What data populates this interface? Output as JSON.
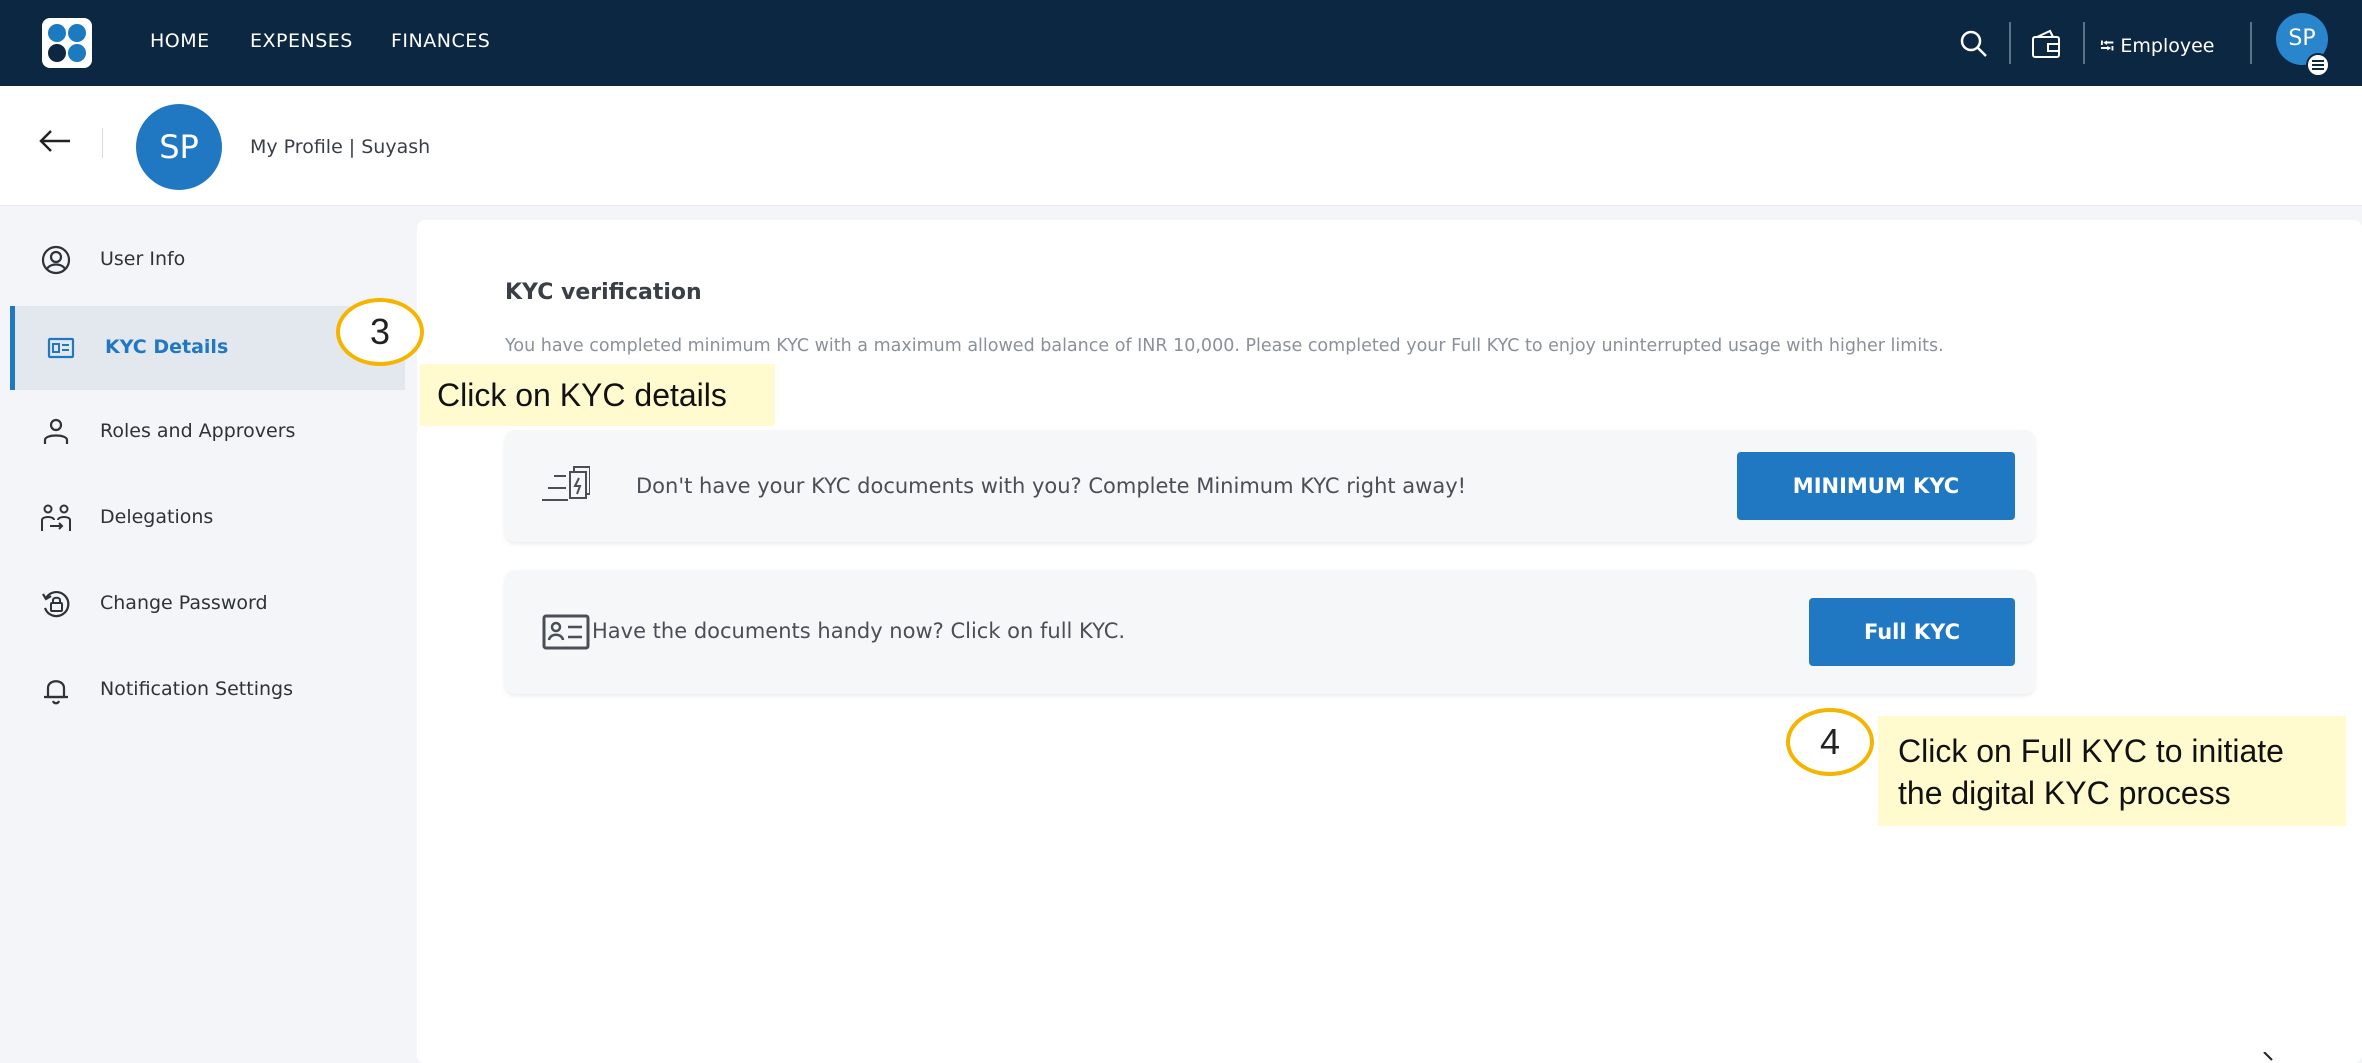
{
  "topnav": {
    "links": [
      "HOME",
      "EXPENSES",
      "FINANCES"
    ],
    "switch_label": "⭾ Employee",
    "avatar": "SP"
  },
  "profile": {
    "avatar": "SP",
    "title": "My Profile | Suyash"
  },
  "sidebar": {
    "items": [
      {
        "label": "User Info",
        "icon": "user-circle-icon"
      },
      {
        "label": "KYC Details",
        "icon": "id-card-icon",
        "active": true
      },
      {
        "label": "Roles and Approvers",
        "icon": "person-icon"
      },
      {
        "label": "Delegations",
        "icon": "people-transfer-icon"
      },
      {
        "label": "Change Password",
        "icon": "password-reset-icon"
      },
      {
        "label": "Notification Settings",
        "icon": "bell-icon"
      }
    ]
  },
  "kyc": {
    "title": "KYC verification",
    "description": "You have completed minimum KYC with a maximum allowed balance of INR 10,000. Please completed your Full KYC to enjoy uninterrupted usage with higher limits.",
    "options": [
      {
        "text": "Don't have your KYC documents with you? Complete Minimum KYC right away!",
        "button": "MINIMUM KYC",
        "icon": "fast-document-icon"
      },
      {
        "text": "Have the documents handy now? Click on full KYC.",
        "button": "Full KYC",
        "icon": "id-card-icon"
      }
    ]
  },
  "annotations": {
    "step3": {
      "number": "3",
      "text": "Click on KYC details"
    },
    "step4": {
      "number": "4",
      "line1": "Click on Full KYC to initiate",
      "line2": "the digital KYC process"
    }
  },
  "colors": {
    "nav_bg": "#0c2742",
    "accent": "#1f78c1",
    "sidebar_bg": "#f3f5f8",
    "annotation_ring": "#f5b400",
    "callout_bg": "#fffbcf"
  }
}
